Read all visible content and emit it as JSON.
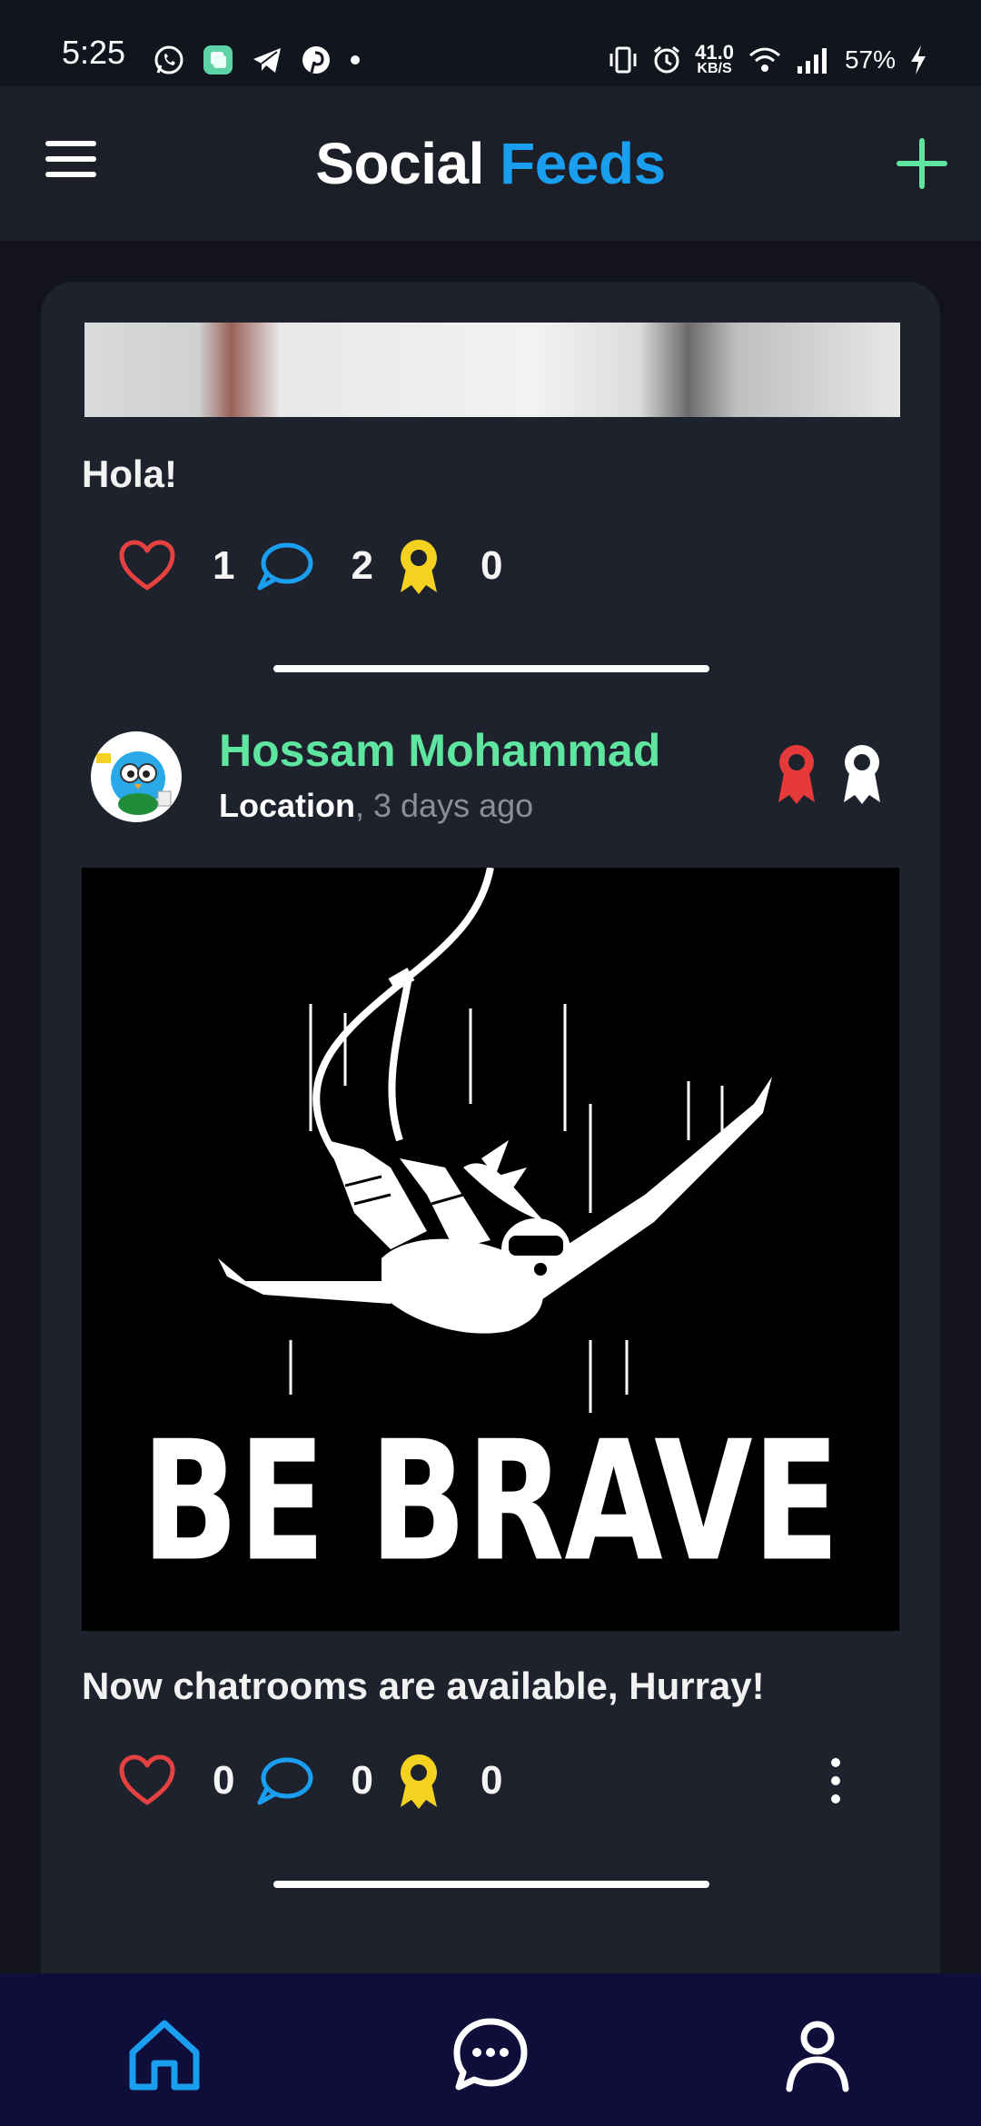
{
  "status_bar": {
    "time": "5:25",
    "speed_value": "41.0",
    "speed_unit": "KB/S",
    "battery": "57%",
    "left_icons": [
      "whatsapp-icon",
      "app-icon",
      "telegram-icon",
      "pinterest-icon",
      "dot-icon"
    ],
    "right_icons": [
      "vibrate-icon",
      "alarm-icon",
      "wifi-icon",
      "signal-icon",
      "charging-icon"
    ]
  },
  "header": {
    "title_part1": "Social",
    "title_part2": "Feeds",
    "accent_color": "#1a9ff0",
    "menu_icon": "hamburger-menu-icon",
    "add_icon": "plus-icon"
  },
  "posts": [
    {
      "caption": "Hola!",
      "likes": "1",
      "comments": "2",
      "awards": "0"
    },
    {
      "author": "Hossam Mohammad",
      "location": "Location",
      "time_ago": ", 3 days ago",
      "image_text": "BE BRAVE",
      "caption": "Now chatrooms are available, Hurray!",
      "likes": "0",
      "comments": "0",
      "awards": "0"
    }
  ],
  "bottom_nav": {
    "items": [
      "home-icon",
      "chat-icon",
      "profile-icon"
    ],
    "active_color": "#1a9ff0"
  }
}
